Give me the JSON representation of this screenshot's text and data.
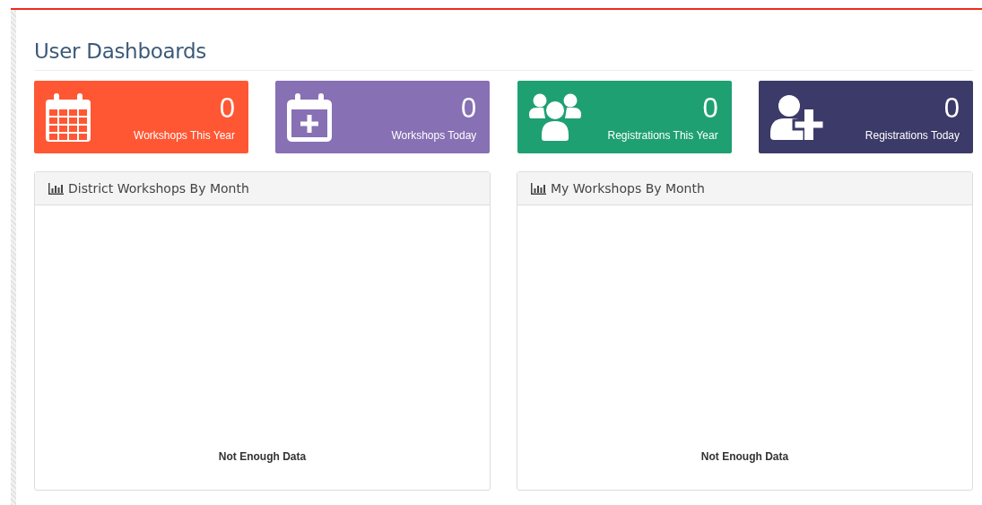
{
  "page_title": "User Dashboards",
  "stats": [
    {
      "value": "0",
      "label": "Workshops This Year",
      "color": "#ff5733"
    },
    {
      "value": "0",
      "label": "Workshops Today",
      "color": "#8770b4"
    },
    {
      "value": "0",
      "label": "Registrations This Year",
      "color": "#1fa073"
    },
    {
      "value": "0",
      "label": "Registrations Today",
      "color": "#3c3a68"
    }
  ],
  "panels": [
    {
      "title": "District Workshops By Month",
      "message": "Not Enough Data"
    },
    {
      "title": "My Workshops By Month",
      "message": "Not Enough Data"
    }
  ]
}
